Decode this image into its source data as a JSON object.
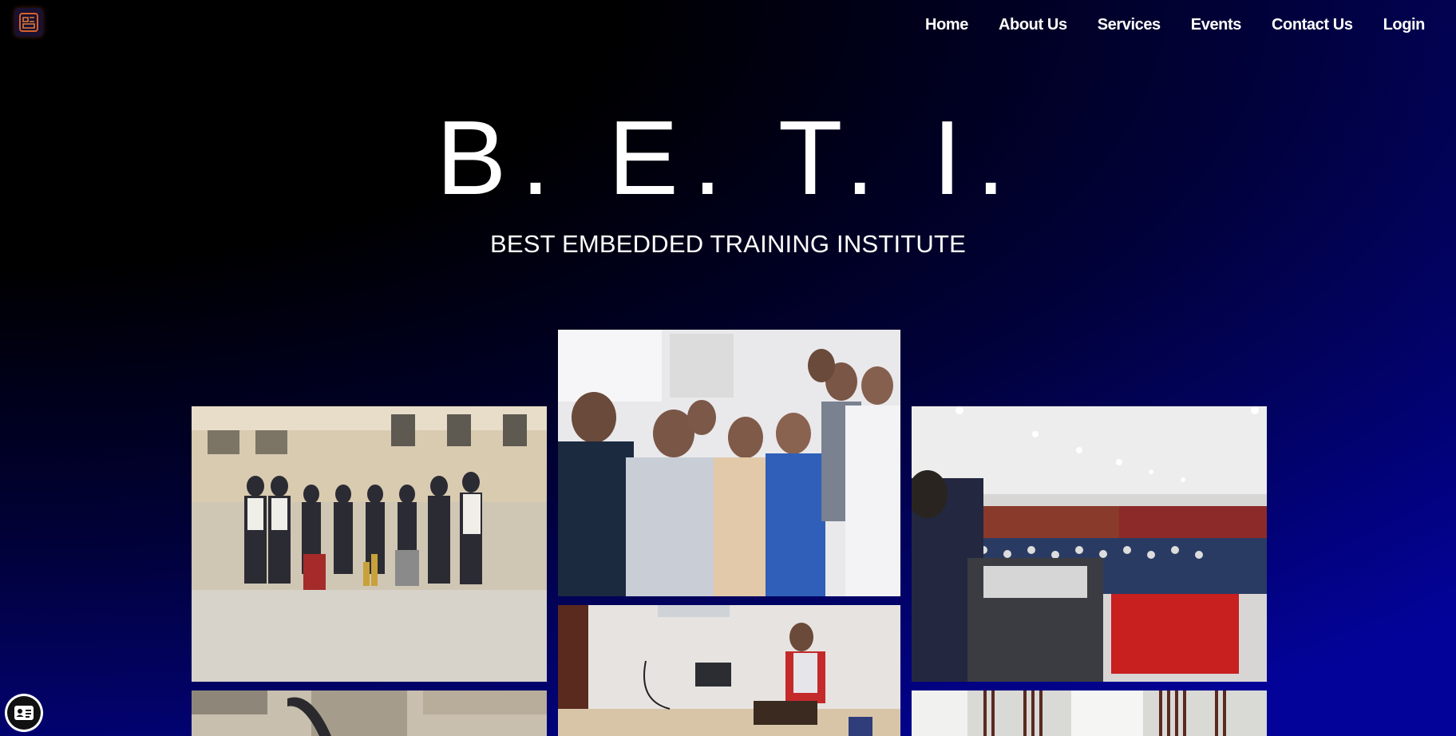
{
  "nav": {
    "items": [
      {
        "label": "Home"
      },
      {
        "label": "About Us"
      },
      {
        "label": "Services"
      },
      {
        "label": "Events"
      },
      {
        "label": "Contact Us"
      },
      {
        "label": "Login"
      }
    ]
  },
  "hero": {
    "title": "B. E. T. I.",
    "subtitle": "BEST EMBEDDED TRAINING INSTITUTE"
  },
  "gallery": {
    "photos": [
      {
        "name": "group-photo-trophies"
      },
      {
        "name": "group-selfie-classroom"
      },
      {
        "name": "auditorium-seminar"
      },
      {
        "name": "student-laptop-workshop"
      },
      {
        "name": "classroom-chairs"
      },
      {
        "name": "windows-hall"
      }
    ]
  },
  "icons": {
    "logo": "beti-logo-icon",
    "floating": "id-card-icon"
  },
  "colors": {
    "background_dark": "#000000",
    "background_blue": "#03039a",
    "text": "#ffffff"
  }
}
